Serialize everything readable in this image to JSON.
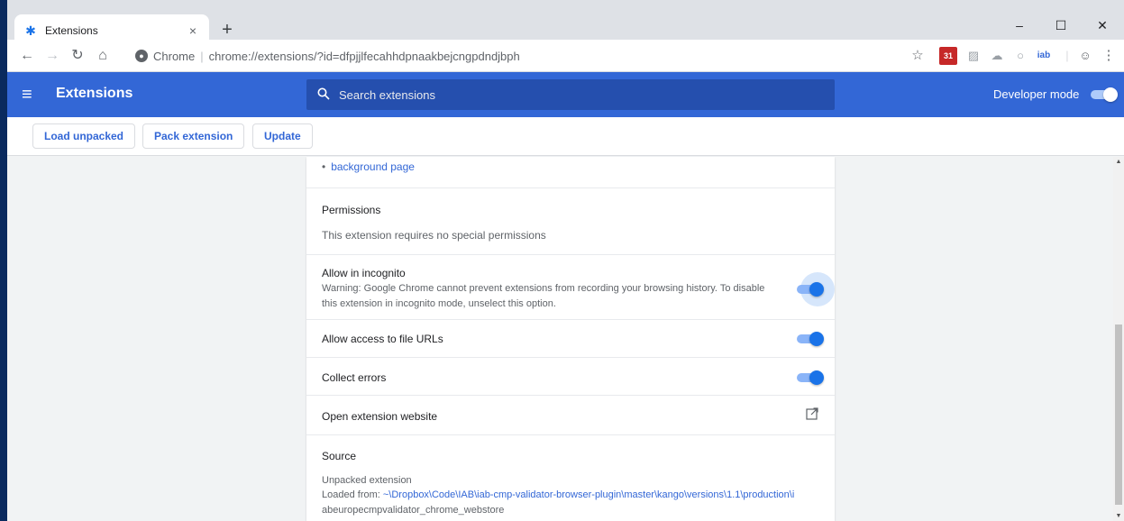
{
  "tab": {
    "title": "Extensions",
    "favicon": "puzzle-icon"
  },
  "window_controls": {
    "minimize": "–",
    "maximize": "☐",
    "close": "✕"
  },
  "omnibox": {
    "scheme": "Chrome",
    "separator": "|",
    "url": "chrome://extensions/?id=dfpjjlfecahhdpnaakbejcngpdndjbph"
  },
  "toolbar_extensions": {
    "calendar_badge": "31",
    "iab_label": "iab"
  },
  "header": {
    "title": "Extensions",
    "search_placeholder": "Search extensions",
    "developer_mode_label": "Developer mode",
    "developer_mode_on": true,
    "accent_color": "#3367d6"
  },
  "devbar": {
    "load_unpacked": "Load unpacked",
    "pack_extension": "Pack extension",
    "update": "Update"
  },
  "details": {
    "background_page_link": "background page",
    "permissions": {
      "title": "Permissions",
      "text": "This extension requires no special permissions"
    },
    "incognito": {
      "title": "Allow in incognito",
      "warning_line1": "Warning: Google Chrome cannot prevent extensions from recording your browsing history. To disable",
      "warning_line2": "this extension in incognito mode, unselect this option.",
      "enabled": true
    },
    "file_urls": {
      "title": "Allow access to file URLs",
      "enabled": true
    },
    "collect_errors": {
      "title": "Collect errors",
      "enabled": true
    },
    "open_website": {
      "title": "Open extension website"
    },
    "source": {
      "title": "Source",
      "type": "Unpacked extension",
      "loaded_from_label": "Loaded from: ",
      "path_line1": "~\\Dropbox\\Code\\IAB\\iab-cmp-validator-browser-plugin\\master\\kango\\versions\\1.1\\production\\i",
      "path_line2": "abeuropecmpvalidator_chrome_webstore"
    }
  }
}
